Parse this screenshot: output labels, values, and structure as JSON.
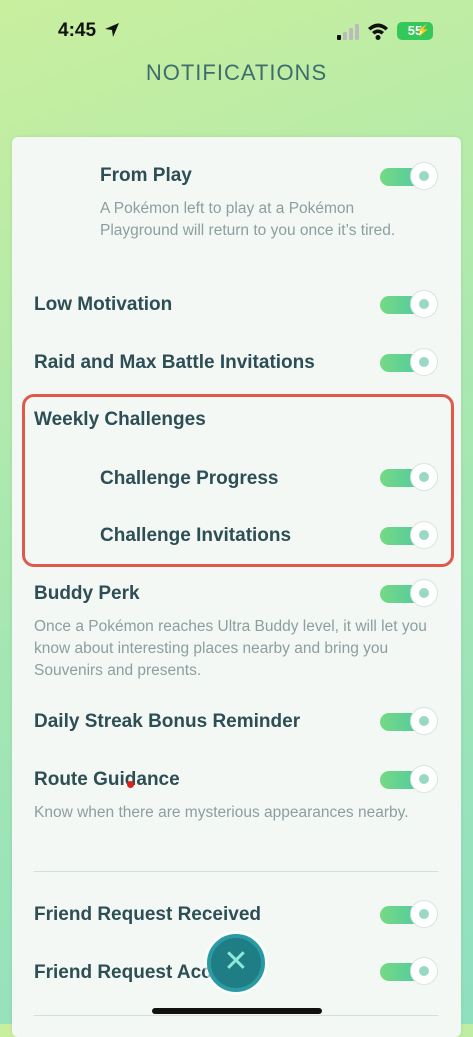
{
  "status_bar": {
    "time": "4:45",
    "battery": "55"
  },
  "page": {
    "title": "NOTIFICATIONS"
  },
  "settings": [
    {
      "label": "From Play",
      "description": "A Pokémon left to play at a Pokémon Playground will return to you once it’s tired.",
      "enabled": true
    },
    {
      "label": "Low Motivation",
      "enabled": true
    },
    {
      "label": "Raid and Max Battle Invitations",
      "enabled": true
    },
    {
      "label": "Weekly Challenges"
    },
    {
      "label": "Challenge Progress",
      "enabled": true
    },
    {
      "label": "Challenge Invitations",
      "enabled": true
    },
    {
      "label": "Buddy Perk",
      "description": "Once a Pokémon reaches Ultra Buddy level, it will let you know about interesting places nearby and bring you Souvenirs and presents.",
      "enabled": true
    },
    {
      "label": "Daily Streak Bonus Reminder",
      "enabled": true
    },
    {
      "label": "Route Guidance",
      "description": "Know when there are mysterious appearances nearby.",
      "enabled": true
    },
    {
      "label": "Friend Request Received",
      "enabled": true
    },
    {
      "label": "Friend Request Accepted",
      "enabled": true
    }
  ],
  "close_glyph": "✕",
  "colors": {
    "highlight": "#e05a4b",
    "toggle_on": "#4fc9a2",
    "title": "#3f6d6e"
  }
}
